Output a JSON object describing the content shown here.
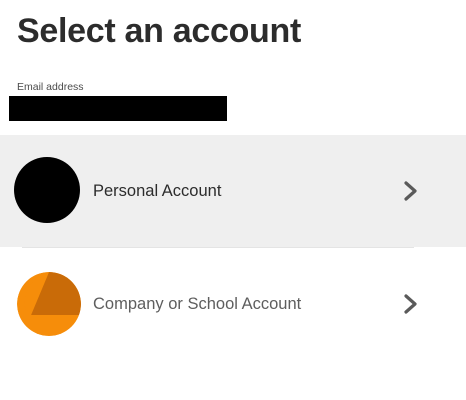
{
  "header": {
    "title": "Select an account"
  },
  "email": {
    "label": "Email address",
    "value_redacted": true
  },
  "accounts": [
    {
      "label": "Personal Account",
      "avatar_icon": "avatar-redacted",
      "chevron_icon": "chevron-right-icon",
      "highlighted": true
    },
    {
      "label": "Company or School Account",
      "avatar_icon": "orange-building-avatar",
      "chevron_icon": "chevron-right-icon",
      "highlighted": false
    }
  ],
  "colors": {
    "highlight_bg": "#efefef",
    "avatar_orange": "#f68d0a",
    "avatar_orange_dark": "#c96b08",
    "text_primary": "#2c2c2c",
    "text_secondary": "#5e5e5e",
    "chevron": "#5a5a5a"
  }
}
